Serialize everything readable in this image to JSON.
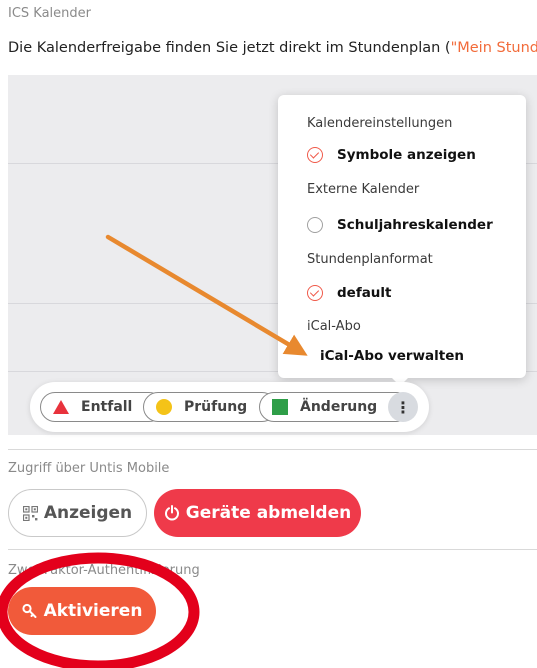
{
  "ics_section": {
    "title": "ICS Kalender",
    "intro_text": "Die Kalenderfreigabe finden Sie jetzt direkt im Stundenplan (",
    "intro_link": "\"Mein Stunder"
  },
  "calendar_menu": {
    "heading_settings": "Kalendereinstellungen",
    "option_symbols": "Symbole anzeigen",
    "heading_external": "Externe Kalender",
    "option_school_year": "Schuljahreskalender",
    "heading_format": "Stundenplanformat",
    "option_default": "default",
    "heading_ical": "iCal-Abo",
    "ical_manage": "iCal-Abo verwalten"
  },
  "legend": {
    "entfall": "Entfall",
    "pruefung": "Prüfung",
    "aenderung": "Änderung",
    "more": "⋮"
  },
  "untis_section": {
    "title": "Zugriff über Untis Mobile",
    "show_button": "Anzeigen",
    "logout_button": "Geräte abmelden"
  },
  "twofa_section": {
    "title": "Zwei-Faktor-Authentifizierung",
    "activate_button": "Aktivieren"
  },
  "colors": {
    "accent": "#f26b3a",
    "danger": "#ef3a4a",
    "annotation_arrow": "#e8892f",
    "annotation_circle": "#e3001b"
  }
}
